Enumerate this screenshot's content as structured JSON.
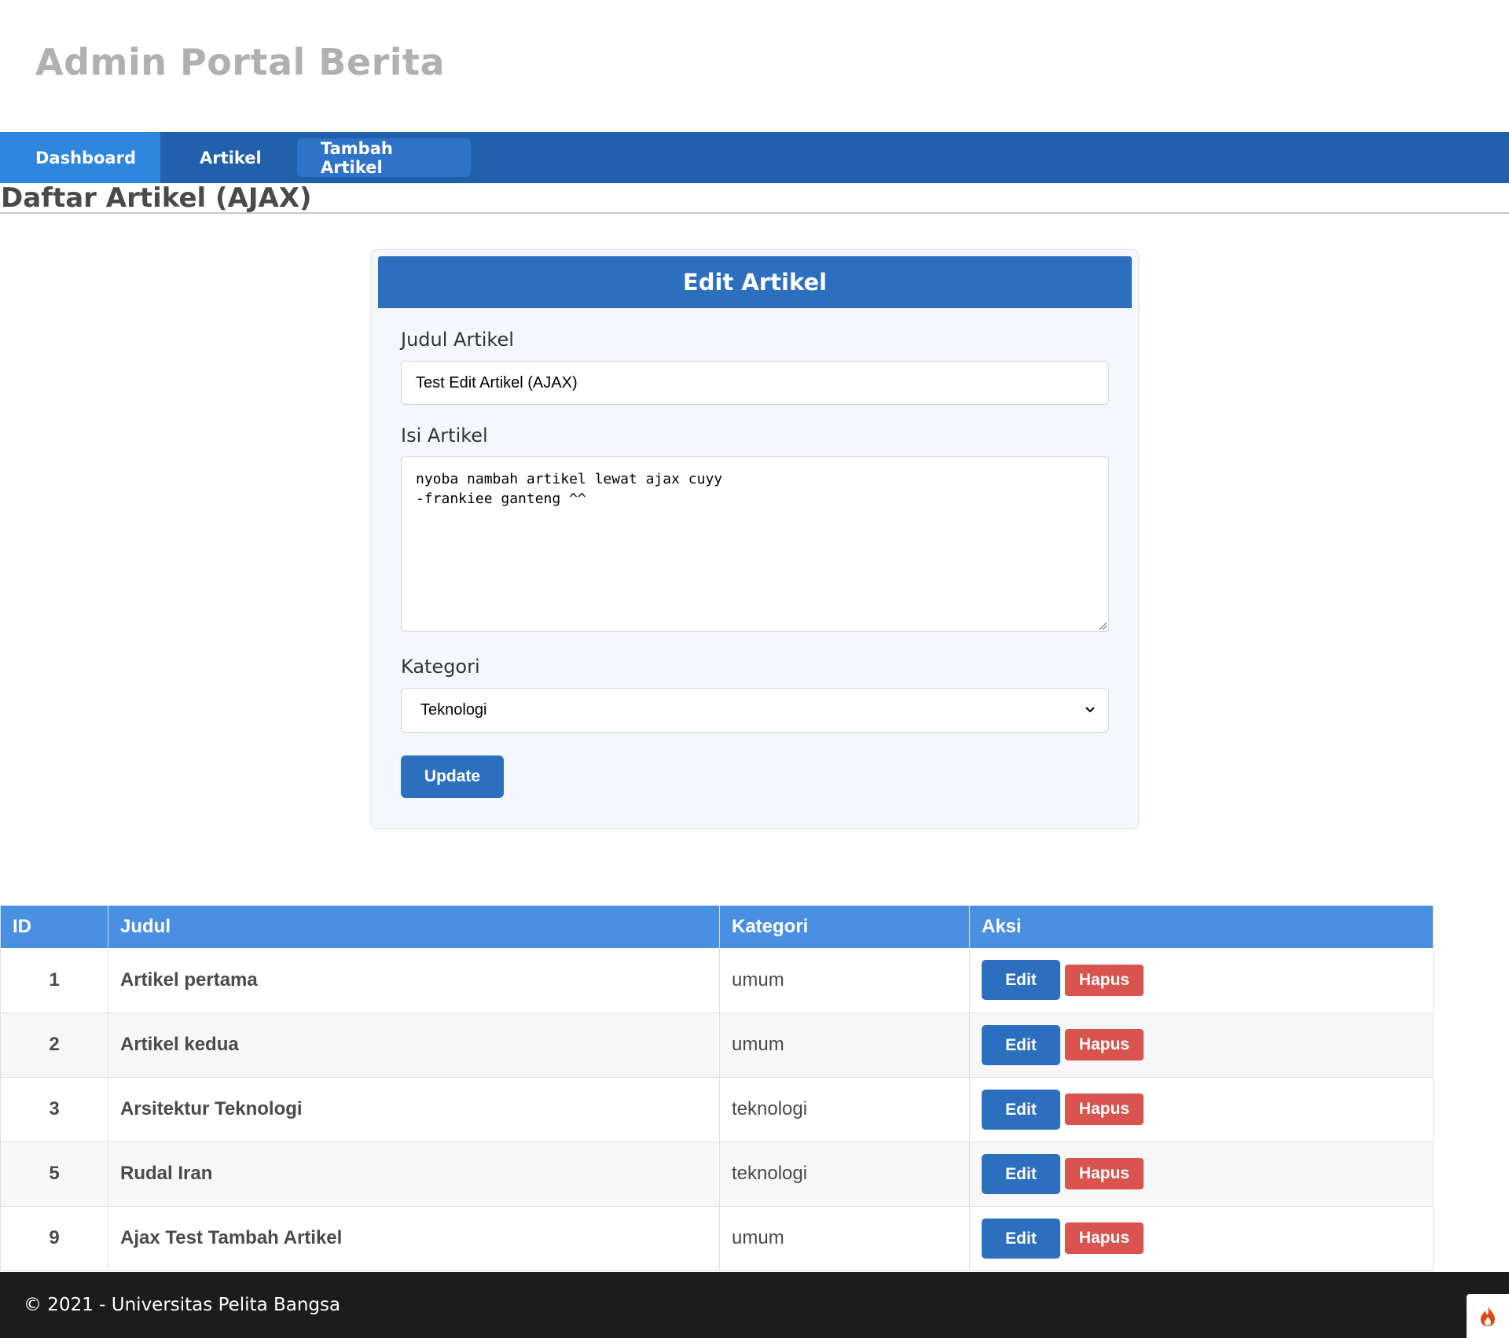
{
  "header": {
    "title": "Admin Portal Berita"
  },
  "nav": {
    "items": [
      {
        "label": "Dashboard"
      },
      {
        "label": "Artikel"
      },
      {
        "label": "Tambah Artikel"
      }
    ]
  },
  "page": {
    "heading": "Daftar Artikel (AJAX)"
  },
  "form": {
    "title": "Edit Artikel",
    "judul_label": "Judul Artikel",
    "judul_value": "Test Edit Artikel (AJAX)",
    "isi_label": "Isi Artikel",
    "isi_value": "nyoba nambah artikel lewat ajax cuyy\n-frankiee ganteng ^^",
    "kategori_label": "Kategori",
    "kategori_value": "Teknologi",
    "submit_label": "Update"
  },
  "table": {
    "headers": [
      "ID",
      "Judul",
      "Kategori",
      "Aksi"
    ],
    "edit_label": "Edit",
    "hapus_label": "Hapus",
    "rows": [
      {
        "id": "1",
        "judul": "Artikel pertama",
        "kategori": "umum"
      },
      {
        "id": "2",
        "judul": "Artikel kedua",
        "kategori": "umum"
      },
      {
        "id": "3",
        "judul": "Arsitektur Teknologi",
        "kategori": "teknologi"
      },
      {
        "id": "5",
        "judul": "Rudal Iran",
        "kategori": "teknologi"
      },
      {
        "id": "9",
        "judul": "Ajax Test Tambah Artikel",
        "kategori": "umum"
      }
    ]
  },
  "footer": {
    "text": "© 2021 - Universitas Pelita Bangsa"
  },
  "icons": {
    "debug_toolbar": "flame-icon",
    "select_arrow": "chevron-down-icon",
    "textarea_resize": "resize-grip-icon"
  },
  "colors": {
    "navbar": "#2161ac",
    "nav_active": "#2e86de",
    "primary_button": "#2d6fbf",
    "danger_button": "#d9534f",
    "table_header": "#4a90e2",
    "footer": "#1c1c1c"
  }
}
